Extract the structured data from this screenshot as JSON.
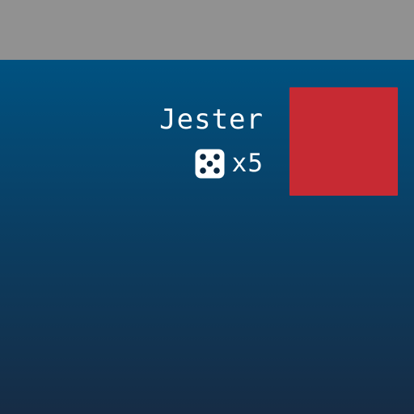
{
  "colors": {
    "top_bar": "#919191",
    "panel_top": "#005281",
    "panel_bottom": "#162c45",
    "avatar": "#c72a33",
    "text": "#ffffff"
  },
  "player": {
    "name": "Jester",
    "dice_count": "x5",
    "dice_icon": "dice-icon"
  }
}
